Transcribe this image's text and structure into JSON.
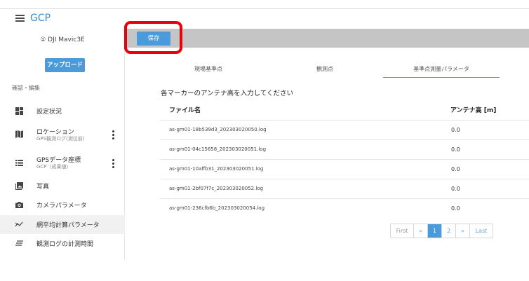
{
  "app": {
    "title": "GCP"
  },
  "sidebar": {
    "device_label": "① DJI Mavic3E",
    "upload_button": "アップロード",
    "section_label": "確認・編集",
    "items": [
      {
        "label": "設定状況",
        "sub": "",
        "icon": "dashboard-icon"
      },
      {
        "label": "ロケーション",
        "sub": "GPS観測ログ(測位前)",
        "icon": "map-icon"
      },
      {
        "label": "GPSデータ座標",
        "sub": "GCP（成果値）",
        "icon": "list-icon"
      },
      {
        "label": "写真",
        "sub": "",
        "icon": "photo-library-icon"
      },
      {
        "label": "カメラパラメータ",
        "sub": "",
        "icon": "camera-icon"
      },
      {
        "label": "網平均計算パラメータ",
        "sub": "",
        "icon": "network-icon"
      },
      {
        "label": "観測ログの計測時間",
        "sub": "",
        "icon": "lines-icon"
      }
    ],
    "active_index": 5
  },
  "toolbar": {
    "save_label": "保存"
  },
  "tabs": [
    "現場基準点",
    "観測点",
    "基準点測量パラメータ"
  ],
  "active_tab": 2,
  "main": {
    "instruction": "各マーカーのアンテナ高を入力してください",
    "columns": [
      "ファイル名",
      "アンテナ高 [m]"
    ],
    "rows": [
      {
        "file": "as-gm01-18b539d3_202303020050.log",
        "height": "0.0"
      },
      {
        "file": "as-gm01-04c15658_202303020051.log",
        "height": "0.0"
      },
      {
        "file": "as-gm01-10affb31_202303020051.log",
        "height": "0.0"
      },
      {
        "file": "as-gm01-2bf07f7c_202303020052.log",
        "height": "0.0"
      },
      {
        "file": "as-gm01-236cfb6b_202303020054.log",
        "height": "0.0"
      }
    ]
  },
  "pagination": {
    "first": "First",
    "prev": "«",
    "pages": [
      "1",
      "2"
    ],
    "next": "»",
    "last": "Last",
    "current": "1"
  },
  "colors": {
    "accent": "#4a9bdc",
    "highlight": "#e8000b",
    "toolbar": "#c5c5c5"
  }
}
